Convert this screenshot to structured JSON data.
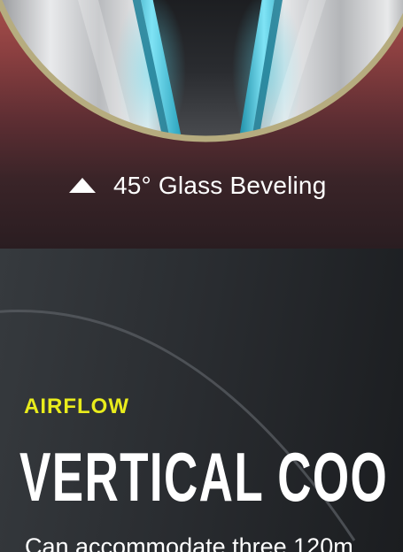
{
  "hero": {
    "caption": "45° Glass Beveling",
    "caption_icon": "triangle-up-icon"
  },
  "airflow": {
    "eyebrow": "AIRFLOW",
    "heading": "VERTICAL COO",
    "description": "Can accommodate three 120m"
  },
  "colors": {
    "eyebrow_accent": "#e9ec1c",
    "hero_top": "#a8504c",
    "hero_bottom": "#2a1d21",
    "section_bg": "#2a2d31",
    "glass_edge": "#3fb6cf",
    "ring": "#b6ac7f"
  }
}
